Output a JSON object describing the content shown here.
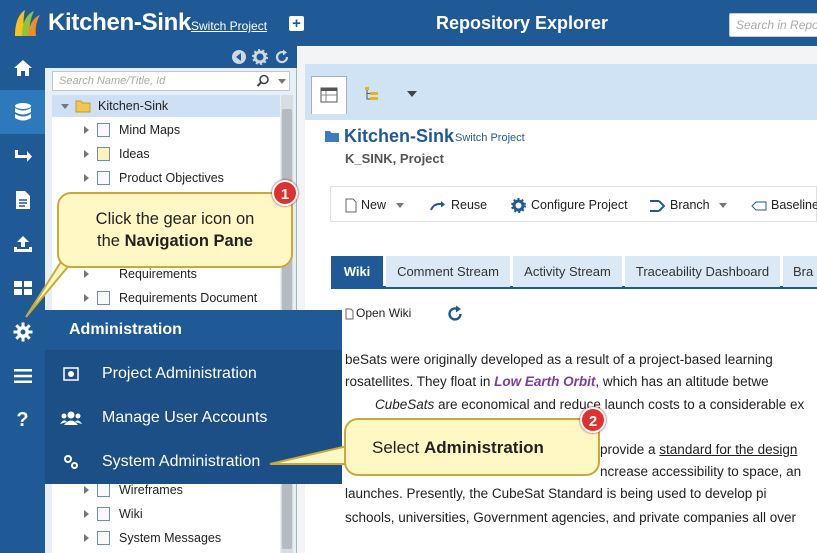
{
  "header": {
    "app_title": "Kitchen-Sink",
    "switch_project": "Switch Project",
    "center_title": "Repository Explorer",
    "search_placeholder": "Search in Repo"
  },
  "tree": {
    "search_placeholder": "Search Name/Title, Id",
    "items": [
      {
        "label": "Kitchen-Sink"
      },
      {
        "label": "Mind Maps"
      },
      {
        "label": "Ideas"
      },
      {
        "label": "Product Objectives"
      },
      {
        "label": "Requirements"
      },
      {
        "label": "Requirements Document"
      },
      {
        "label": "Wireframes"
      },
      {
        "label": "Wiki"
      },
      {
        "label": "System Messages"
      }
    ]
  },
  "project": {
    "title": "Kitchen-Sink",
    "switch": "Switch Project",
    "key": "K_SINK, Project"
  },
  "toolbar": {
    "new": "New",
    "reuse": "Reuse",
    "configure": "Configure Project",
    "branch": "Branch",
    "baseline": "Baseline"
  },
  "tabs": [
    "Wiki",
    "Comment Stream",
    "Activity Stream",
    "Traceability Dashboard",
    "Bra"
  ],
  "open_wiki": "Open Wiki",
  "wiki": {
    "line1": "beSats were originally developed as a result of a project-based learning",
    "line2a": "rosatellites. They float in ",
    "line2b": "Low Earth Orbit",
    "line2c": ", which has an altitude betwe",
    "line3a": "CubeSats",
    "line3b": " are economical and reduce launch costs to a considerable ex",
    "line4a": "provide a ",
    "line4b": "standard for the design",
    "line5": "ncrease accessibility to space, an",
    "line6": "launches. Presently, the CubeSat Standard is being used to develop pi",
    "line7": "schools, universities, Government agencies, and private companies all over"
  },
  "admin_menu": {
    "header": "Administration",
    "items": [
      "Project Administration",
      "Manage User Accounts",
      "System Administration"
    ]
  },
  "callouts": {
    "one_a": "Click the gear icon on",
    "one_b": "the ",
    "one_c": "Navigation Pane",
    "two_a": "Select ",
    "two_b": "Administration",
    "badge1": "1",
    "badge2": "2"
  },
  "colors": {
    "brand": "#1f5a96",
    "callout": "#fff8c5",
    "badge": "#e03131",
    "link": "#7a3ea1"
  }
}
